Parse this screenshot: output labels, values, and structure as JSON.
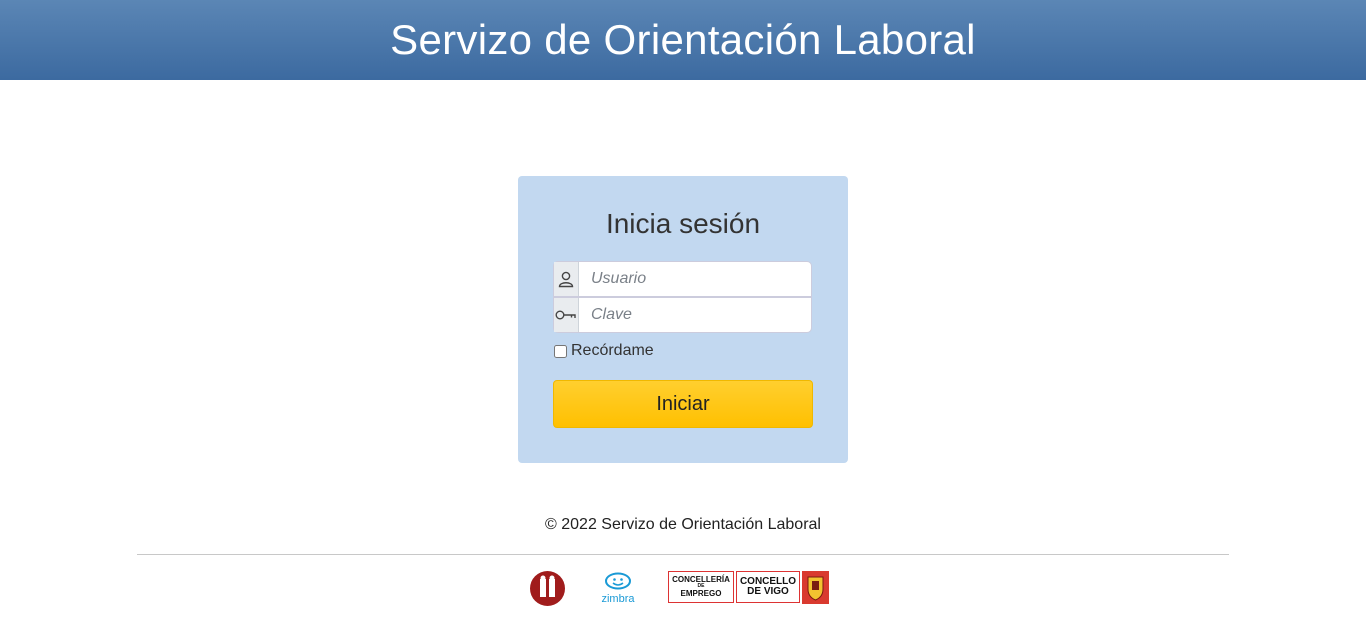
{
  "header": {
    "title": "Servizo de Orientación Laboral"
  },
  "login": {
    "title": "Inicia sesión",
    "username": {
      "placeholder": "Usuario",
      "value": "",
      "icon": "user-icon"
    },
    "password": {
      "placeholder": "Clave",
      "value": "",
      "icon": "key-icon"
    },
    "remember_label": "Recórdame",
    "remember_checked": false,
    "submit_label": "Iniciar"
  },
  "footer": {
    "copyright": "© 2022 Servizo de Orientación Laboral",
    "logos": {
      "zimbra": "zimbra",
      "emprego_top": "CONCELLERÍA",
      "emprego_mid": "DE",
      "emprego_bottom": "EMPREGO",
      "vigo_line1": "CONCELLO",
      "vigo_line2": "DE VIGO"
    }
  },
  "colors": {
    "header": "#4a77ab",
    "login_panel": "#c2d8f0",
    "button": "#ffc515",
    "brand_red": "#a01c1c",
    "zimbra_blue": "#1a9ad6"
  }
}
